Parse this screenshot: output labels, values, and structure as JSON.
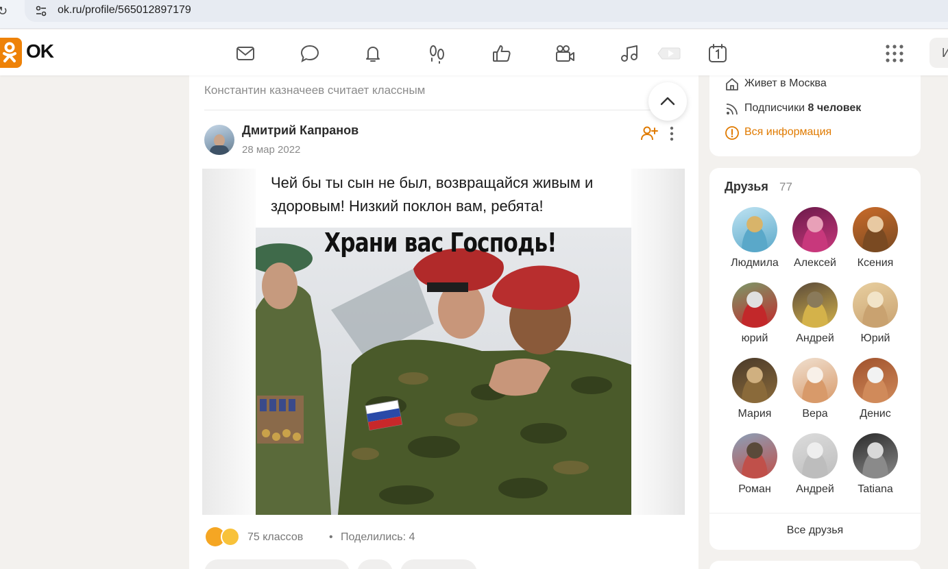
{
  "browser": {
    "url": "ok.ru/profile/565012897179"
  },
  "header": {
    "logo_text": "OK",
    "brand_color": "#ee8208",
    "nav_icons": [
      "mail-icon",
      "chat-icon",
      "bell-icon",
      "footprints-icon",
      "like-icon",
      "video-camera-icon",
      "music-icon",
      "video-play-icon",
      "calendar-icon"
    ],
    "search_stub": "И"
  },
  "post": {
    "liked_by": "Константин казначеев считает классным",
    "author": "Дмитрий Капранов",
    "date": "28 мар 2022",
    "caption": "Чей бы ты сын не был, возвращайся живым и здоровым! Низкий поклон вам, ребята!",
    "image_title": "Храни вас Господь!",
    "classes": "75 классов",
    "separator": "•",
    "shares": "Поделились: 4"
  },
  "profile_info": {
    "city": "Живет в Москва",
    "subscribers_label": "Подписчики",
    "subscribers_value": "8 человек",
    "all_info": "Вся информация",
    "link_color": "#e07a00"
  },
  "friends": {
    "title": "Друзья",
    "count": "77",
    "items": [
      {
        "name": "Людмила",
        "colors": [
          "#bfe3f2",
          "#5aa8c9",
          "#d8b46a"
        ]
      },
      {
        "name": "Алексей",
        "colors": [
          "#6b1a4a",
          "#c8387c",
          "#e8a0b8"
        ]
      },
      {
        "name": "Ксения",
        "colors": [
          "#c96b2a",
          "#7a4a22",
          "#e8c9a2"
        ]
      },
      {
        "name": "юрий",
        "colors": [
          "#7a9a6a",
          "#c2282a",
          "#e0e0e0"
        ]
      },
      {
        "name": "Андрей",
        "colors": [
          "#5a4a3a",
          "#d4b24a",
          "#8a7a5a"
        ]
      },
      {
        "name": "Юрий",
        "colors": [
          "#e8cfa0",
          "#c9a270",
          "#f2e4c8"
        ]
      },
      {
        "name": "Мария",
        "colors": [
          "#4a3a2a",
          "#8a6a3a",
          "#d0b080"
        ]
      },
      {
        "name": "Вера",
        "colors": [
          "#f0e0d0",
          "#d89a6a",
          "#f8f0e8"
        ]
      },
      {
        "name": "Денис",
        "colors": [
          "#a0522d",
          "#d08a5a",
          "#f2f2f2"
        ]
      },
      {
        "name": "Роман",
        "colors": [
          "#8aa0b8",
          "#c0504a",
          "#5a4a3a"
        ]
      },
      {
        "name": "Андрей",
        "colors": [
          "#dcdcdc",
          "#bdbdbd",
          "#eeeeee"
        ]
      },
      {
        "name": "Tatiana",
        "colors": [
          "#2a2a2a",
          "#8a8a8a",
          "#d8d8d8"
        ]
      }
    ],
    "all_friends": "Все друзья"
  }
}
